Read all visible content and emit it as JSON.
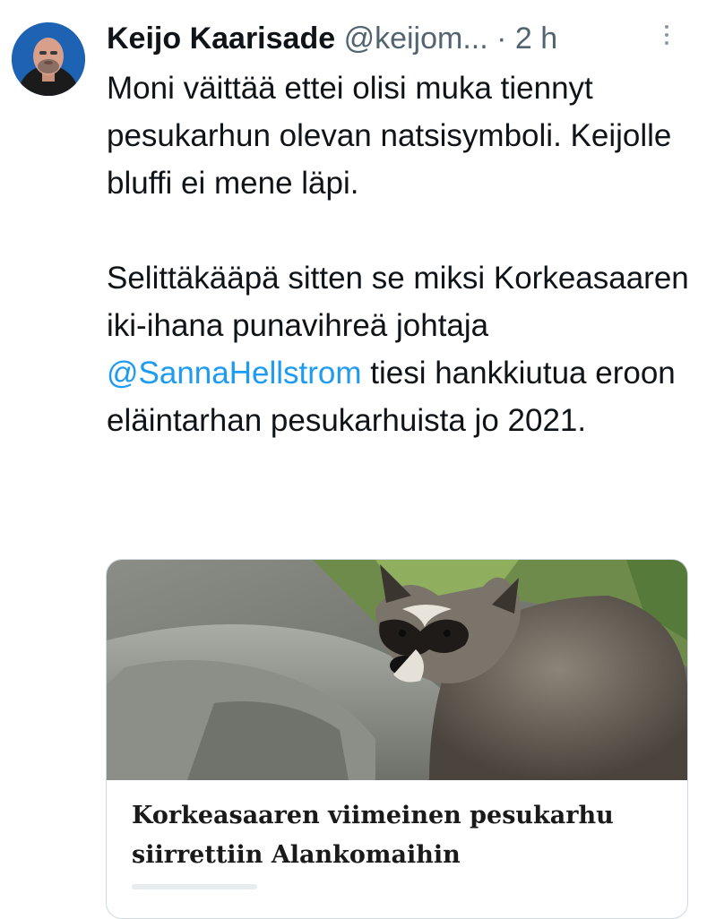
{
  "tweet": {
    "author": {
      "display_name": "Keijo Kaarisade",
      "handle": "@keijom...",
      "separator": "·",
      "timestamp": "2 h"
    },
    "text": {
      "para1": "Moni väittää ettei olisi muka tiennyt pesukarhun olevan natsisymboli. Keijolle bluffi ei mene läpi.",
      "para2_before": "Selittäkääpä sitten se miksi Korkeasaaren iki-ihana punavihreä johtaja ",
      "mention": "@SannaHellstrom",
      "para2_after": " tiesi hankkiutua eroon eläintarhan pesukarhuista jo 2021."
    },
    "link_card": {
      "title": "Korkeasaaren viimeinen pesukarhu siirrettiin Alankomaihin",
      "image_subject": "raccoon-photo"
    }
  },
  "icons": {
    "more": "more-vertical-icon"
  },
  "colors": {
    "text_primary": "#0f1419",
    "text_secondary": "#536471",
    "link": "#1d9bf0",
    "card_border": "#cfd9de"
  }
}
